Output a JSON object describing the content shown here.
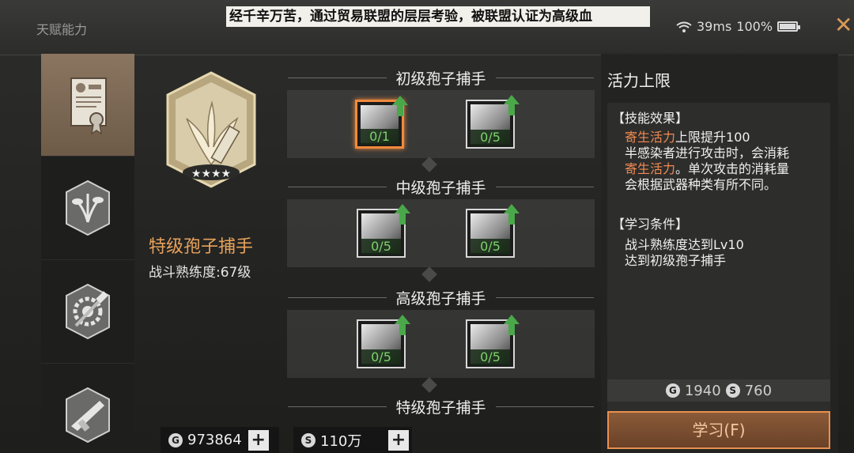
{
  "window": {
    "title": "天赋能力"
  },
  "marquee": "经千辛万苦，通过贸易联盟的层层考验，被联盟认证为高级血",
  "status": {
    "ping": "39ms",
    "battery": "100%"
  },
  "sidebar": {
    "tabs": [
      {
        "name": "trade-certificate",
        "active": true
      },
      {
        "name": "plant-badge",
        "active": false
      },
      {
        "name": "gear-hammer-badge",
        "active": false
      },
      {
        "name": "weapon-badge",
        "active": false
      }
    ]
  },
  "rank": {
    "name": "特级孢子捕手",
    "level": "战斗熟练度:67级"
  },
  "tiers": [
    {
      "label": "初级孢子捕手",
      "skills": [
        {
          "count": "0/1",
          "selected": true
        },
        {
          "count": "0/5",
          "selected": false
        }
      ]
    },
    {
      "label": "中级孢子捕手",
      "skills": [
        {
          "count": "0/5",
          "selected": false
        },
        {
          "count": "0/5",
          "selected": false
        }
      ]
    },
    {
      "label": "高级孢子捕手",
      "skills": [
        {
          "count": "0/5",
          "selected": false
        },
        {
          "count": "0/5",
          "selected": false
        }
      ]
    },
    {
      "label": "特级孢子捕手",
      "skills": []
    }
  ],
  "detail": {
    "title": "活力上限",
    "effect_header": "【技能效果】",
    "effect_lines": [
      [
        {
          "t": "寄生活力",
          "hl": true
        },
        {
          "t": "上限提升100",
          "hl": false
        }
      ],
      [
        {
          "t": "半感染者进行攻击时，会消耗",
          "hl": false
        }
      ],
      [
        {
          "t": "寄生活力",
          "hl": true
        },
        {
          "t": "。单次攻击的消耗量",
          "hl": false
        }
      ],
      [
        {
          "t": "会根据武器种类有所不同。",
          "hl": false
        }
      ]
    ],
    "req_header": "【学习条件】",
    "req_lines": [
      "战斗熟练度达到Lv10",
      "达到初级孢子捕手"
    ],
    "cost_g": "1940",
    "cost_s": "760",
    "learn_button": "学习(F)"
  },
  "currency": {
    "g_amount": "973864",
    "s_amount": "110万",
    "g_symbol": "G",
    "s_symbol": "S",
    "plus": "+"
  },
  "colors": {
    "accent": "#e89050",
    "highlight": "#f08a50",
    "progress": "#7cd36a"
  }
}
